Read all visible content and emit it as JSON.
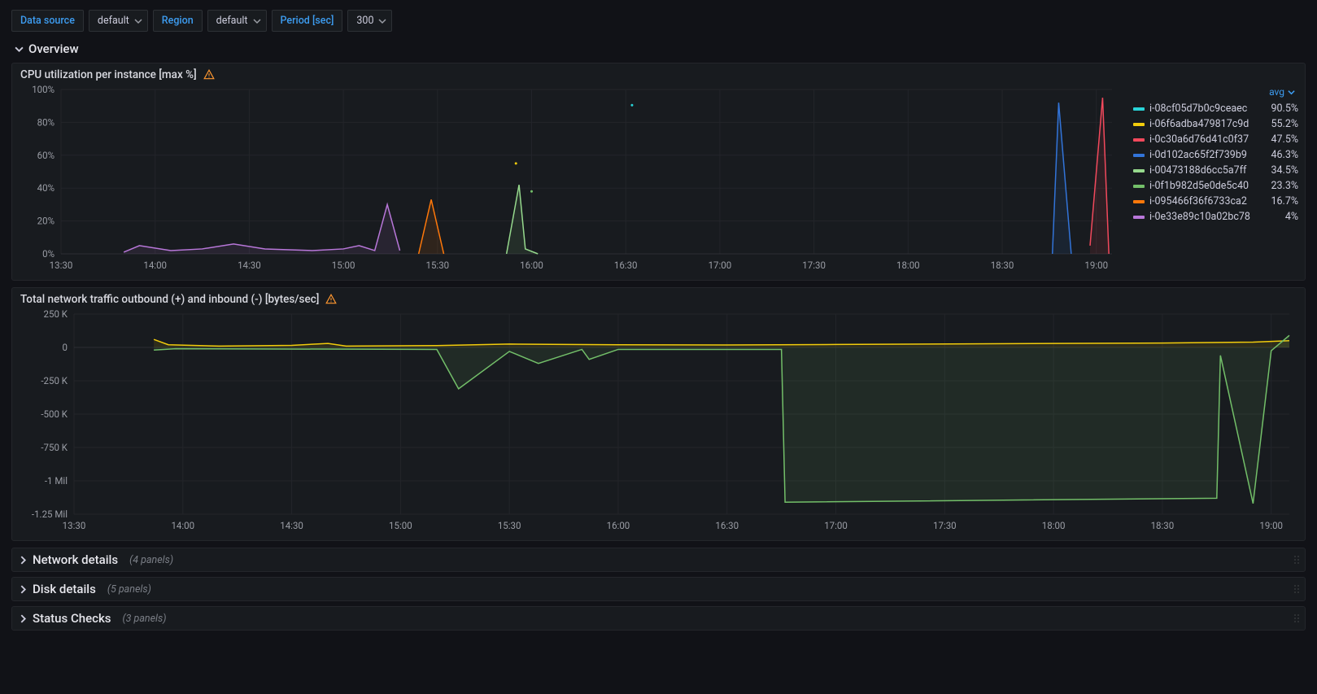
{
  "variables": {
    "data_source": {
      "label": "Data source",
      "value": "default"
    },
    "region": {
      "label": "Region",
      "value": "default"
    },
    "period": {
      "label": "Period [sec]",
      "value": "300"
    }
  },
  "overview": {
    "title": "Overview"
  },
  "rows": {
    "network": {
      "title": "Network details",
      "count_label": "(4 panels)"
    },
    "disk": {
      "title": "Disk details",
      "count_label": "(5 panels)"
    },
    "status": {
      "title": "Status Checks",
      "count_label": "(3 panels)"
    }
  },
  "chart_data": [
    {
      "type": "line",
      "title": "CPU utilization per instance [max %]",
      "xlabel": "",
      "ylabel": "",
      "x_ticks": [
        "13:30",
        "14:00",
        "14:30",
        "15:00",
        "15:30",
        "16:00",
        "16:30",
        "17:00",
        "17:30",
        "18:00",
        "18:30",
        "19:00"
      ],
      "y_ticks": [
        "0%",
        "20%",
        "40%",
        "60%",
        "80%",
        "100%"
      ],
      "ylim": [
        0,
        100
      ],
      "legend_sort": "avg",
      "series": [
        {
          "name": "i-08cf05d7b0c9ceaec",
          "color": "#29d4d8",
          "avg": "90.5%",
          "points": [
            {
              "x": "16:32",
              "y": 90.5
            }
          ]
        },
        {
          "name": "i-06f6adba479817c9d",
          "color": "#f2cc0c",
          "avg": "55.2%",
          "points": [
            {
              "x": "15:55",
              "y": 55
            }
          ]
        },
        {
          "name": "i-0c30a6d76d41c0f37",
          "color": "#f2495c",
          "avg": "47.5%",
          "points": [
            {
              "x": "18:58",
              "y": 5
            },
            {
              "x": "19:02",
              "y": 95
            },
            {
              "x": "19:04",
              "y": 0
            }
          ]
        },
        {
          "name": "i-0d102ac65f2f739b9",
          "color": "#3274d9",
          "avg": "46.3%",
          "points": [
            {
              "x": "18:46",
              "y": 0
            },
            {
              "x": "18:48",
              "y": 92
            },
            {
              "x": "18:52",
              "y": 0
            }
          ]
        },
        {
          "name": "i-00473188d6cc5a7ff",
          "color": "#96d98d",
          "avg": "34.5%",
          "points": [
            {
              "x": "15:52",
              "y": 0
            },
            {
              "x": "15:56",
              "y": 42
            },
            {
              "x": "15:58",
              "y": 3
            },
            {
              "x": "16:02",
              "y": 0
            }
          ]
        },
        {
          "name": "i-0f1b982d5e0de5c40",
          "color": "#73bf69",
          "avg": "23.3%",
          "points": [
            {
              "x": "16:00",
              "y": 38
            }
          ]
        },
        {
          "name": "i-095466f36f6733ca2",
          "color": "#ff780a",
          "avg": "16.7%",
          "points": [
            {
              "x": "15:24",
              "y": 0
            },
            {
              "x": "15:28",
              "y": 33
            },
            {
              "x": "15:32",
              "y": 0
            }
          ]
        },
        {
          "name": "i-0e33e89c10a02bc78",
          "color": "#b877d9",
          "avg": "4%",
          "points": [
            {
              "x": "13:50",
              "y": 1
            },
            {
              "x": "13:55",
              "y": 5
            },
            {
              "x": "14:05",
              "y": 2
            },
            {
              "x": "14:15",
              "y": 3
            },
            {
              "x": "14:25",
              "y": 6
            },
            {
              "x": "14:35",
              "y": 3
            },
            {
              "x": "14:50",
              "y": 2
            },
            {
              "x": "15:00",
              "y": 3
            },
            {
              "x": "15:05",
              "y": 5
            },
            {
              "x": "15:10",
              "y": 2
            },
            {
              "x": "15:14",
              "y": 30
            },
            {
              "x": "15:18",
              "y": 2
            }
          ]
        }
      ]
    },
    {
      "type": "line",
      "title": "Total network traffic outbound (+) and inbound (-) [bytes/sec]",
      "xlabel": "",
      "ylabel": "",
      "x_ticks": [
        "13:30",
        "14:00",
        "14:30",
        "15:00",
        "15:30",
        "16:00",
        "16:30",
        "17:00",
        "17:30",
        "18:00",
        "18:30",
        "19:00"
      ],
      "y_ticks": [
        "-1.25 Mil",
        "-1 Mil",
        "-750 K",
        "-500 K",
        "-250 K",
        "0",
        "250 K"
      ],
      "ylim": [
        -1250000,
        250000
      ],
      "series": [
        {
          "name": "outbound",
          "color": "#f2cc0c",
          "points": [
            {
              "x": "13:52",
              "y": 60000
            },
            {
              "x": "13:56",
              "y": 20000
            },
            {
              "x": "14:10",
              "y": 10000
            },
            {
              "x": "14:30",
              "y": 15000
            },
            {
              "x": "14:40",
              "y": 30000
            },
            {
              "x": "14:45",
              "y": 10000
            },
            {
              "x": "15:10",
              "y": 14000
            },
            {
              "x": "15:30",
              "y": 25000
            },
            {
              "x": "16:00",
              "y": 20000
            },
            {
              "x": "16:30",
              "y": 18000
            },
            {
              "x": "17:00",
              "y": 22000
            },
            {
              "x": "18:00",
              "y": 30000
            },
            {
              "x": "18:30",
              "y": 33000
            },
            {
              "x": "18:55",
              "y": 40000
            },
            {
              "x": "19:05",
              "y": 50000
            }
          ]
        },
        {
          "name": "inbound",
          "color": "#73bf69",
          "points": [
            {
              "x": "13:52",
              "y": -20000
            },
            {
              "x": "13:58",
              "y": -10000
            },
            {
              "x": "15:10",
              "y": -15000
            },
            {
              "x": "15:16",
              "y": -310000
            },
            {
              "x": "15:30",
              "y": -30000
            },
            {
              "x": "15:38",
              "y": -120000
            },
            {
              "x": "15:50",
              "y": -15000
            },
            {
              "x": "15:52",
              "y": -90000
            },
            {
              "x": "16:00",
              "y": -15000
            },
            {
              "x": "16:45",
              "y": -15000
            },
            {
              "x": "16:46",
              "y": -1160000
            },
            {
              "x": "18:45",
              "y": -1130000
            },
            {
              "x": "18:46",
              "y": -60000
            },
            {
              "x": "18:55",
              "y": -1170000
            },
            {
              "x": "19:00",
              "y": -25000
            },
            {
              "x": "19:05",
              "y": 90000
            }
          ]
        }
      ]
    }
  ]
}
